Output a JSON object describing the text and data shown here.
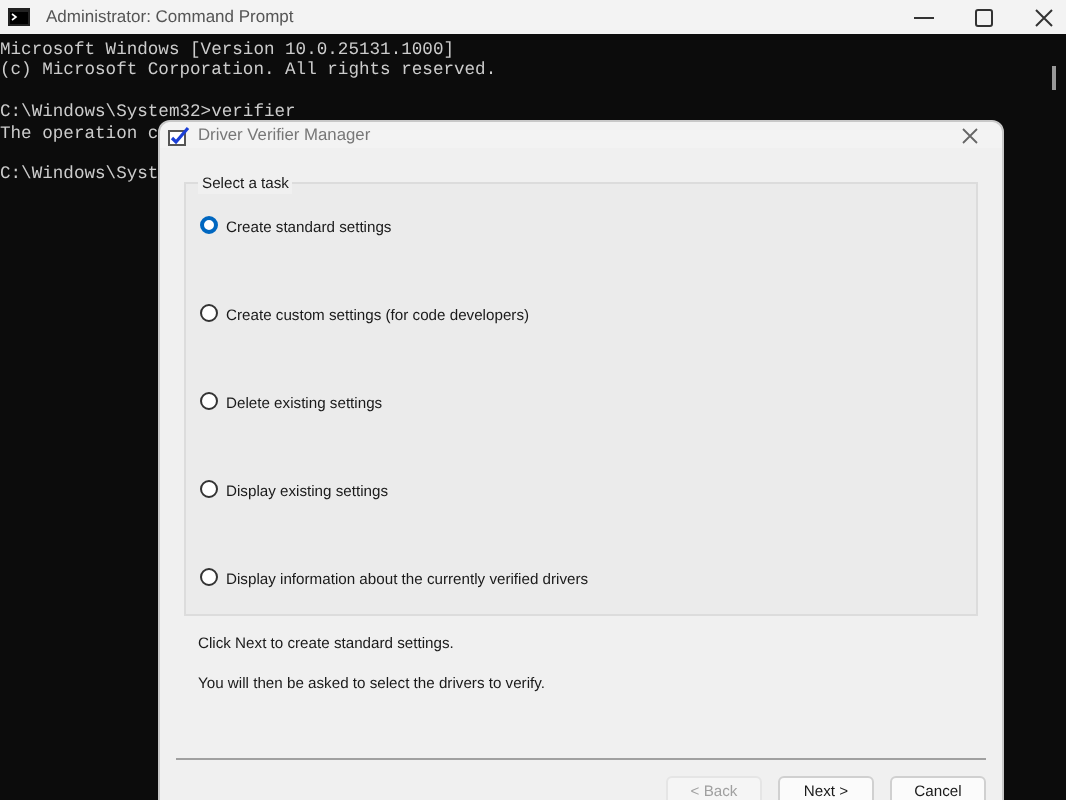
{
  "console_window": {
    "title": "Administrator: Command Prompt",
    "lines": [
      {
        "text": "Microsoft Windows [Version 10.0.25131.1000]",
        "blank_line_before": false
      },
      {
        "text": "(c) Microsoft Corporation. All rights reserved.",
        "blank_line_before": false
      },
      {
        "text": "C:\\Windows\\System32>verifier",
        "blank_line_before": true
      },
      {
        "text": "The operation c",
        "blank_line_before": false
      },
      {
        "text": "C:\\Windows\\Syst",
        "blank_line_before": true
      }
    ]
  },
  "dialog": {
    "title": "Driver Verifier Manager",
    "group_label": "Select a task",
    "options": [
      {
        "label": "Create standard settings",
        "selected": true
      },
      {
        "label": "Create custom settings (for code developers)",
        "selected": false
      },
      {
        "label": "Delete existing settings",
        "selected": false
      },
      {
        "label": "Display existing settings",
        "selected": false
      },
      {
        "label": "Display information about the currently verified drivers",
        "selected": false
      }
    ],
    "description": [
      "Click Next to create standard settings.",
      "You will then be asked to select the drivers to verify."
    ],
    "buttons": [
      {
        "label": "< Back",
        "disabled": true
      },
      {
        "label": "Next >",
        "disabled": false
      },
      {
        "label": "Cancel",
        "disabled": false
      }
    ]
  }
}
